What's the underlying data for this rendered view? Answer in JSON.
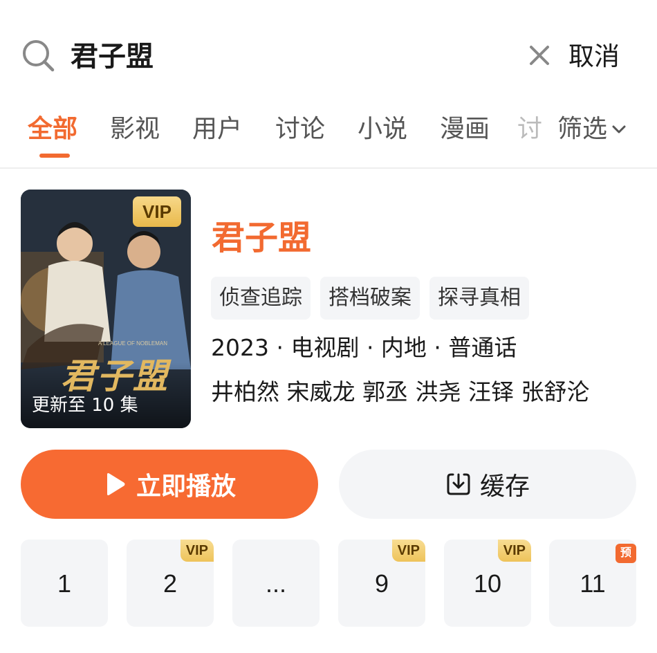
{
  "search": {
    "query": "君子盟",
    "cancel_label": "取消"
  },
  "tabs": [
    {
      "label": "全部",
      "active": true
    },
    {
      "label": "影视",
      "active": false
    },
    {
      "label": "用户",
      "active": false
    },
    {
      "label": "讨论",
      "active": false
    },
    {
      "label": "小说",
      "active": false
    },
    {
      "label": "漫画",
      "active": false
    }
  ],
  "tab_overflow_glyph": "讨",
  "filter_label": "筛选",
  "show": {
    "title": "君子盟",
    "poster": {
      "vip_badge": "VIP",
      "title_art": "君子盟",
      "subtitle_art": "A LEAGUE OF NOBLEMAN",
      "update_status": "更新至 10 集"
    },
    "tags": [
      "侦查追踪",
      "搭档破案",
      "探寻真相"
    ],
    "meta": "2023 · 电视剧 · 内地 · 普通话",
    "cast": "井柏然 宋威龙 郭丞 洪尧 汪铎 张舒沦"
  },
  "actions": {
    "play_label": "立即播放",
    "download_label": "缓存"
  },
  "episodes": [
    {
      "label": "1",
      "badge": ""
    },
    {
      "label": "2",
      "badge": "VIP"
    },
    {
      "label": "...",
      "badge": ""
    },
    {
      "label": "9",
      "badge": "VIP"
    },
    {
      "label": "10",
      "badge": "VIP"
    },
    {
      "label": "11",
      "badge": "预"
    }
  ],
  "colors": {
    "accent": "#f26a30",
    "play_button": "#f76a32",
    "vip_gold": "#eec35a",
    "chip_bg": "#f4f5f7"
  }
}
